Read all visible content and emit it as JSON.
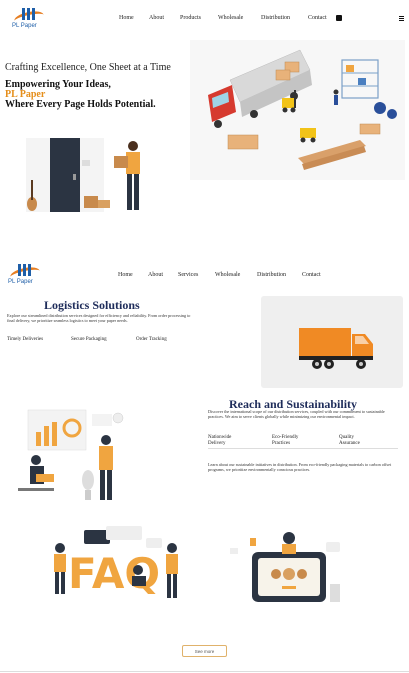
{
  "brand": {
    "name": "PL Paper"
  },
  "nav1": [
    "Home",
    "About",
    "Products",
    "Wholesale",
    "Distribution",
    "Contact"
  ],
  "nav2": [
    "Home",
    "About",
    "Services",
    "Wholesale",
    "Distribution",
    "Contact"
  ],
  "hero": {
    "tagline": "Crafting Excellence, One Sheet at a Time",
    "headline_1": "Empowering Your Ideas,",
    "headline_brand": "PL Paper",
    "headline_2": "Where Every Page Holds Potential."
  },
  "logistics": {
    "title": "Logistics Solutions",
    "body": "Explore our streamlined distribution services designed for efficiency and reliability. From order processing to final delivery, we prioritize seamless logistics to meet your paper needs.",
    "features": [
      "Timely Deliveries",
      "Secure Packaging",
      "Order Tracking"
    ]
  },
  "reach": {
    "title": "Reach and Sustainability",
    "body": "Discover the international scope of our distribution services, coupled with our commitment to sustainable practices. We aim to serve clients globally while minimizing our environmental impact.",
    "features": [
      {
        "line1": "Nationwide",
        "line2": "Delivery"
      },
      {
        "line1": "Eco-Friendly",
        "line2": "Practices"
      },
      {
        "line1": "Quality",
        "line2": "Assurance"
      }
    ],
    "more": "Learn about our sustainable initiatives in distribution. From eco-friendly packaging materials to carbon offset programs, we prioritize environmentally conscious practices."
  },
  "faq_word": "FAQ",
  "see_more": "See more",
  "colors": {
    "accent": "#e58e1a",
    "navy": "#1e2c5a",
    "truck": "#f08a24",
    "brand_blue": "#1f5fa8"
  }
}
